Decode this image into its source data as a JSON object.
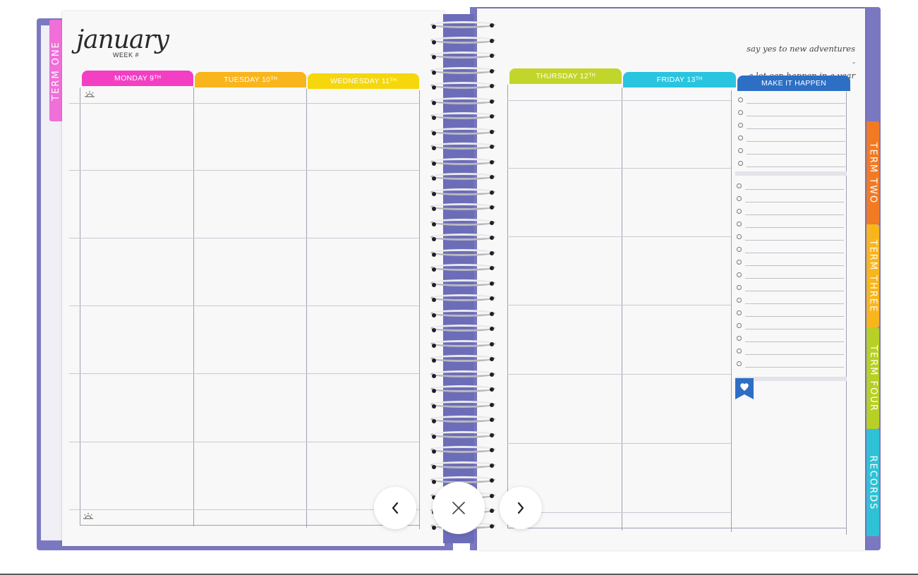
{
  "planner": {
    "month": "january",
    "week_label": "WEEK #",
    "quote_line1": "say yes to new adventures -",
    "quote_line2": "a lot can happen in a year",
    "left_days": [
      {
        "label": "MONDAY 9ᵀᴴ",
        "color": "#f23fc4"
      },
      {
        "label": "TUESDAY 10ᵀᴴ",
        "color": "#f9b51c"
      },
      {
        "label": "WEDNESDAY 11ᵀᴴ",
        "color": "#f5d70c"
      }
    ],
    "right_days": [
      {
        "label": "THURSDAY 12ᵀᴴ",
        "color": "#c2d52a"
      },
      {
        "label": "FRIDAY 13ᵀᴴ",
        "color": "#29c4e0"
      },
      {
        "label": "MAKE IT HAPPEN",
        "color": "#2d6fc5"
      }
    ],
    "tabs": {
      "term_one": {
        "label": "TERM ONE",
        "color": "#f06fd9"
      },
      "term_two": {
        "label": "TERM TWO",
        "color": "#f27a23"
      },
      "term_three": {
        "label": "TERM THREE",
        "color": "#f9b51c"
      },
      "term_four": {
        "label": "TERM FOUR",
        "color": "#b8cf25"
      },
      "records": {
        "label": "RECORDS",
        "color": "#2fc2d6"
      }
    }
  },
  "controls": {
    "prev_icon": "chevron-left-icon",
    "close_icon": "close-icon",
    "next_icon": "chevron-right-icon"
  }
}
